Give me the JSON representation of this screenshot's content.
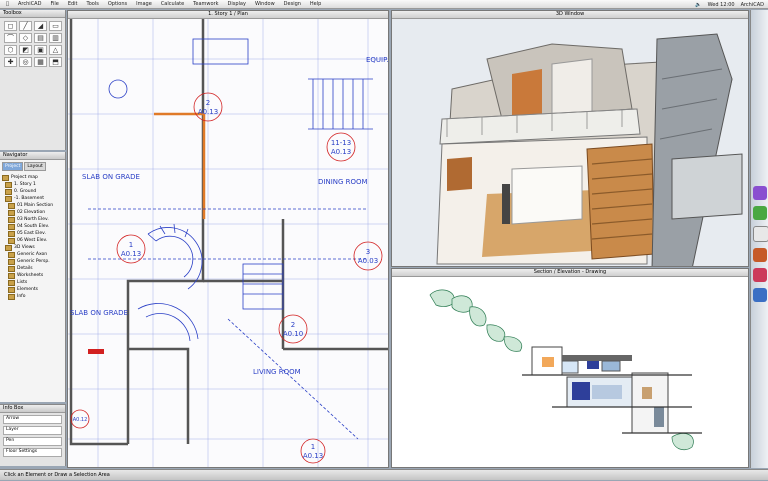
{
  "menubar": {
    "items": [
      "ArchiCAD",
      "File",
      "Edit",
      "Tools",
      "Options",
      "Image",
      "Calculate",
      "Teamwork",
      "Display",
      "Window",
      "Design",
      "Help"
    ],
    "clock": "Wed 12:00",
    "app_name": "ArchiCAD"
  },
  "toolbox": {
    "title": "Toolbox",
    "tools": [
      "◻",
      "╱",
      "◢",
      "▭",
      "⌒",
      "◇",
      "▤",
      "▥",
      "⬡",
      "◩",
      "▣",
      "△",
      "✚",
      "◎",
      "▦",
      "⬒"
    ]
  },
  "navigator": {
    "title": "Navigator",
    "tabs": [
      "Project",
      "Layout"
    ],
    "items": [
      "Project map",
      "1. Story 1",
      "0. Ground",
      "-1. Basement",
      "01 Main Section",
      "02 Elevation",
      "03 North Elev.",
      "04 South Elev.",
      "05 East Elev.",
      "06 West Elev.",
      "3D Views",
      "Generic Axon",
      "Generic Persp.",
      "Details",
      "Worksheets",
      "Lists",
      "Elements",
      "Info"
    ]
  },
  "infobox": {
    "title": "Info Box",
    "rows": [
      "Arrow",
      "Layer",
      "Pen",
      "Floor Settings"
    ]
  },
  "plan": {
    "title": "1. Story 1 / Plan",
    "labels": {
      "slab1": "SLAB ON GRADE",
      "slab2": "SLAB ON GRADE",
      "dining": "DINING ROOM",
      "living": "LIVING ROOM",
      "equip": "EQUIP."
    },
    "markers": [
      {
        "num": "2",
        "ref": "A0.13"
      },
      {
        "num": "11-13",
        "ref": "A0.13"
      },
      {
        "num": "1",
        "ref": "A0.13"
      },
      {
        "num": "3",
        "ref": "A0.03"
      },
      {
        "num": "2",
        "ref": "A0.10"
      },
      {
        "num": "A0.12",
        "ref": ""
      },
      {
        "num": "1",
        "ref": "A0.13"
      }
    ]
  },
  "w3d": {
    "title": "3D Window"
  },
  "wsec": {
    "title": "Section / Elevation - Drawing"
  },
  "statusbar": {
    "text": "Click an Element or Draw a Selection Area"
  },
  "colors": {
    "plan_line": "#2a3fc6",
    "marker": "#d22020",
    "wall": "#e07a28"
  }
}
